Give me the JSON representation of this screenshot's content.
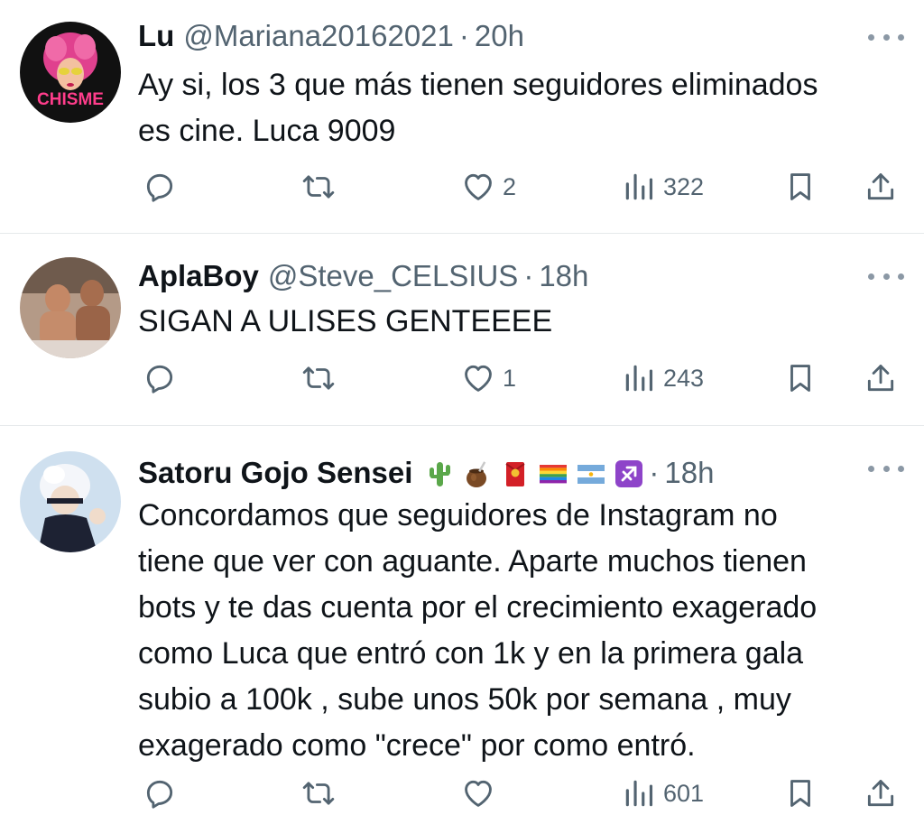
{
  "tweets": [
    {
      "name": "Lu",
      "handle": "@Mariana20162021",
      "separator": "·",
      "time": "20h",
      "avatar_label": "CHISME",
      "text_lines": [
        "Ay si, los 3 que más tienen seguidores eliminados",
        "es cine. Luca 9009"
      ],
      "likes": "2",
      "views": "322"
    },
    {
      "name": "AplaBoy",
      "handle": "@Steve_CELSIUS",
      "separator": "·",
      "time": "18h",
      "text_lines": [
        "SIGAN A ULISES GENTEEEE"
      ],
      "likes": "1",
      "views": "243"
    },
    {
      "name": "Satoru Gojo Sensei",
      "handle": "",
      "separator": "·",
      "time": "18h",
      "name_emojis": [
        "cactus-emoji",
        "mate-emoji",
        "red-envelope-emoji",
        "rainbow-flag-emoji",
        "argentina-flag-emoji",
        "sagittarius-emoji"
      ],
      "text_lines": [
        "Concordamos que seguidores de Instagram no",
        "tiene que ver con aguante. Aparte muchos tienen",
        "bots y te das cuenta por el crecimiento exagerado",
        "como Luca que entró con 1k y en la primera gala",
        "subio a 100k , sube unos 50k por semana , muy",
        "exagerado como \"crece\" por como entró."
      ],
      "likes": "",
      "views": "601"
    }
  ],
  "colors": {
    "text": "#0f1419",
    "secondary": "#536471",
    "divider": "#e6e9eb",
    "icon": "#536471"
  }
}
